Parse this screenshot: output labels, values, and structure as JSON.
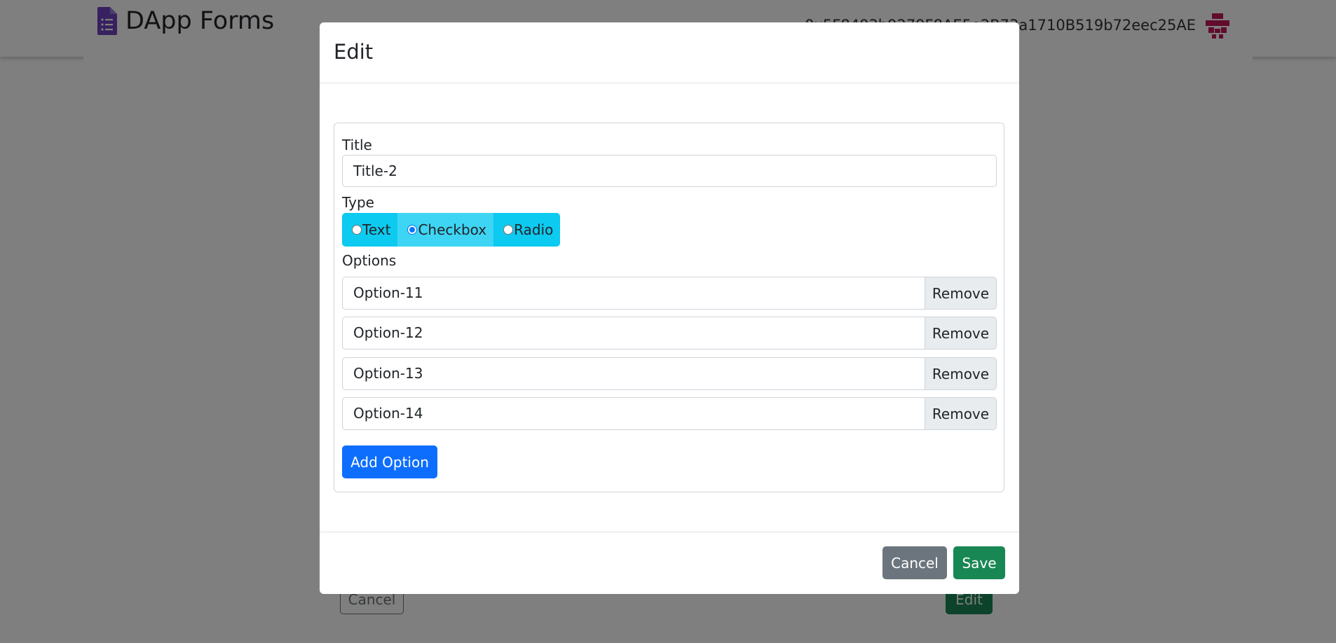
{
  "navbar": {
    "brand_icon": "form-document-icon",
    "brand_title": "DApp Forms",
    "account_address": "0x5F8403b9279F8AE5e2B73a1710B519b72eec25AE",
    "avatar_icon": "identicon-avatar-icon"
  },
  "background_page": {
    "cancel_label": "Cancel",
    "edit_label": "Edit"
  },
  "modal": {
    "title": "Edit",
    "title_field_label": "Title",
    "title_value": "Title-2",
    "type_label": "Type",
    "type_options": [
      {
        "label": "Text",
        "selected": false
      },
      {
        "label": "Checkbox",
        "selected": true
      },
      {
        "label": "Radio",
        "selected": false
      }
    ],
    "options_label": "Options",
    "options": [
      {
        "value": "Option-11",
        "remove_label": "Remove"
      },
      {
        "value": "Option-12",
        "remove_label": "Remove"
      },
      {
        "value": "Option-13",
        "remove_label": "Remove"
      },
      {
        "value": "Option-14",
        "remove_label": "Remove"
      }
    ],
    "add_option_label": "Add Option",
    "cancel_label": "Cancel",
    "save_label": "Save"
  },
  "colors": {
    "primary": "#0d6efd",
    "success": "#198754",
    "secondary": "#6c757d",
    "info": "#0dcaf0",
    "brand_icon": "#6f42c1",
    "avatar": "#c2185b"
  }
}
